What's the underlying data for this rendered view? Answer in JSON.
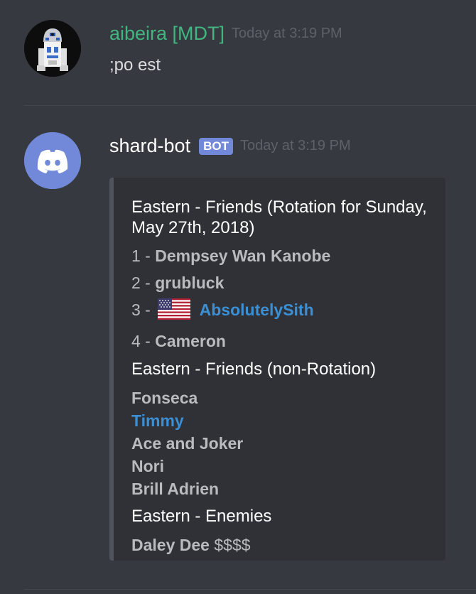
{
  "messages": [
    {
      "username": "aibeira [MDT]",
      "timestamp": "Today at 3:19 PM",
      "content": ";po est",
      "avatar_icon": "r2d2-avatar-icon"
    },
    {
      "username": "shard-bot",
      "bot_tag": "BOT",
      "timestamp": "Today at 3:19 PM",
      "avatar_icon": "discord-logo-icon",
      "embed": {
        "rotation_title": "Eastern - Friends (Rotation for Sunday, May 27th, 2018)",
        "rotation": [
          {
            "num": "1 - ",
            "name": "Dempsey Wan Kanobe"
          },
          {
            "num": "2 - ",
            "name": "grubluck"
          },
          {
            "num": "3 - ",
            "name": "AbsolutelySith",
            "flag": "us-flag-icon"
          },
          {
            "num": "4 - ",
            "name": "Cameron"
          }
        ],
        "non_rotation_title": "Eastern - Friends (non-Rotation)",
        "non_rotation": [
          "Fonseca",
          "Timmy",
          "Ace and Joker",
          "Nori",
          "Brill Adrien"
        ],
        "enemies_title": "Eastern - Enemies",
        "enemies": [
          {
            "name": "Daley Dee",
            "suffix": " $$$$"
          }
        ]
      }
    }
  ],
  "colors": {
    "background": "#36393f",
    "embed_bg": "#2f3136",
    "username_green": "#43b581",
    "link_blue": "#3b8fd4",
    "bot_tag": "#7289da"
  }
}
